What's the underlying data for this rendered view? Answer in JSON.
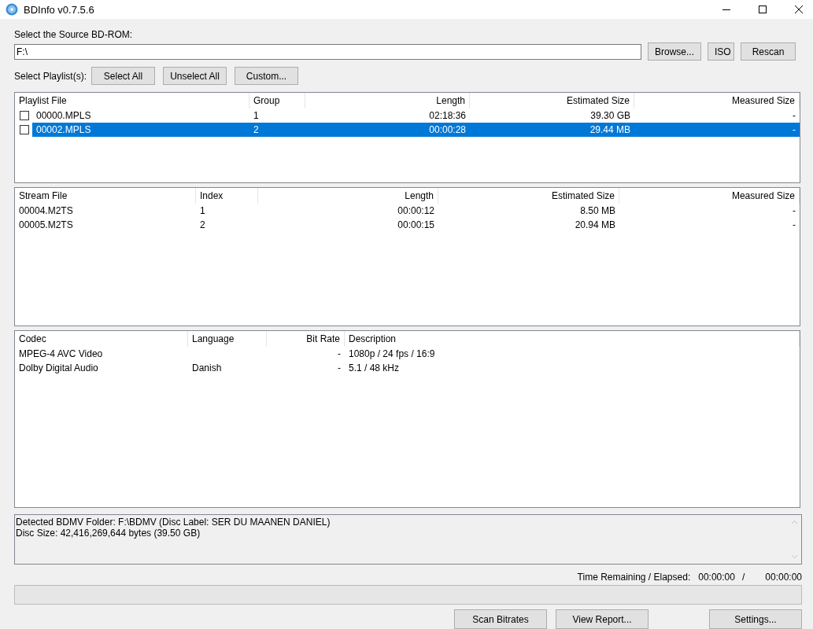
{
  "window": {
    "title": "BDInfo v0.7.5.6"
  },
  "source": {
    "label": "Select the Source BD-ROM:",
    "value": "F:\\",
    "buttons": [
      "Browse...",
      "ISO",
      "Rescan"
    ]
  },
  "playlist_select": {
    "label": "Select Playlist(s):",
    "buttons": [
      "Select All",
      "Unselect All",
      "Custom..."
    ]
  },
  "playlists": {
    "columns": [
      "Playlist File",
      "Group",
      "Length",
      "Estimated Size",
      "Measured Size"
    ],
    "rows": [
      {
        "cells": [
          "00000.MPLS",
          "1",
          "02:18:36",
          "39.30 GB",
          "-"
        ],
        "checked": false,
        "selected": false
      },
      {
        "cells": [
          "00002.MPLS",
          "2",
          "00:00:28",
          "29.44 MB",
          "-"
        ],
        "checked": false,
        "selected": true
      }
    ]
  },
  "streams": {
    "columns": [
      "Stream File",
      "Index",
      "Length",
      "Estimated Size",
      "Measured Size"
    ],
    "rows": [
      [
        "00004.M2TS",
        "1",
        "00:00:12",
        "8.50 MB",
        "-"
      ],
      [
        "00005.M2TS",
        "2",
        "00:00:15",
        "20.94 MB",
        "-"
      ]
    ]
  },
  "codecs": {
    "columns": [
      "Codec",
      "Language",
      "Bit Rate",
      "Description"
    ],
    "rows": [
      [
        "MPEG-4 AVC Video",
        "",
        "-",
        "1080p / 24 fps / 16:9"
      ],
      [
        "Dolby Digital Audio",
        "Danish",
        "-",
        "5.1 / 48 kHz"
      ]
    ]
  },
  "log": [
    "Detected BDMV Folder: F:\\BDMV (Disc Label: SER DU MAANEN DANIEL)",
    "Disc Size: 42,416,269,644 bytes (39.50 GB)"
  ],
  "time": {
    "label": "Time Remaining / Elapsed:",
    "remaining": "00:00:00",
    "separator": "/",
    "elapsed": "00:00:00"
  },
  "progress": {
    "level": 0
  },
  "buttons": [
    "Scan Bitrates",
    "View Report...",
    "Settings..."
  ]
}
